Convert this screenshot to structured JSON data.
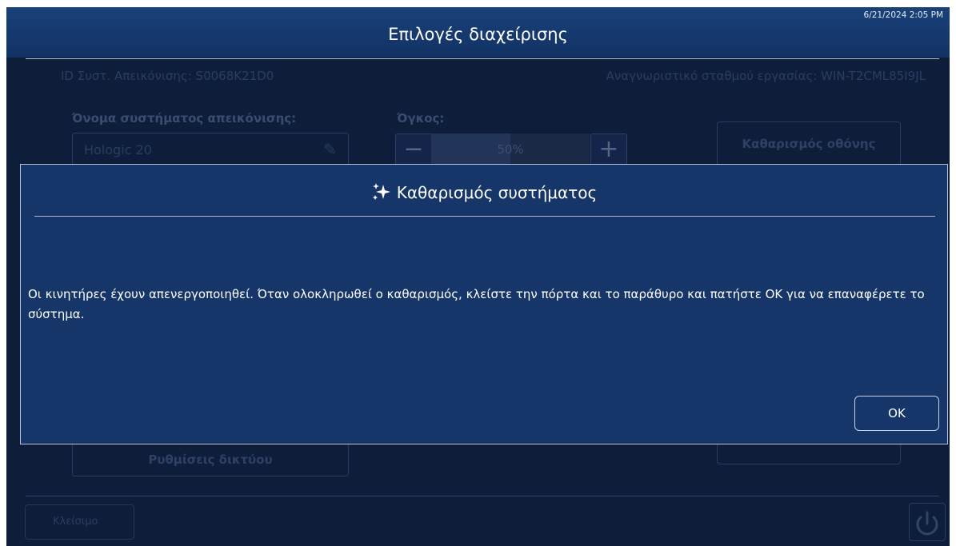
{
  "header": {
    "title": "Επιλογές διαχείρισης",
    "timestamp": "6/21/2024 2:05 PM"
  },
  "background": {
    "system_id": "ID Συστ. Απεικόνισης: S0068K21D0",
    "workstation_id": "Αναγνωριστικό σταθμού εργασίας: WIN-T2CML85I9JL",
    "name_label": "Όνομα συστήματος απεικόνισης:",
    "name_value": "Hologic 20",
    "volume_label": "Όγκος:",
    "volume_value": "50%",
    "volume_level": 0.5,
    "clean_screen_button": "Καθαρισμός οθόνης",
    "network_settings_button": "Ρυθμίσεις δικτύου",
    "close_button": "Κλείσιμο"
  },
  "dialog": {
    "title": "Καθαρισμός συστήματος",
    "message": "Οι κινητήρες έχουν απενεργοποιηθεί. Όταν ολοκληρωθεί ο καθαρισμός, κλείστε την πόρτα και το παράθυρο και πατήστε ΟΚ για να επαναφέρετε το σύστημα.",
    "ok_button": "OK"
  },
  "colors": {
    "screen_bg": "#0e1d3a",
    "header_bg": "#19417a",
    "dialog_bg": "#163568",
    "text": "#ffffff"
  },
  "icons": [
    "pencil-icon",
    "minus-icon",
    "plus-icon",
    "sparkle-icon",
    "power-icon"
  ]
}
